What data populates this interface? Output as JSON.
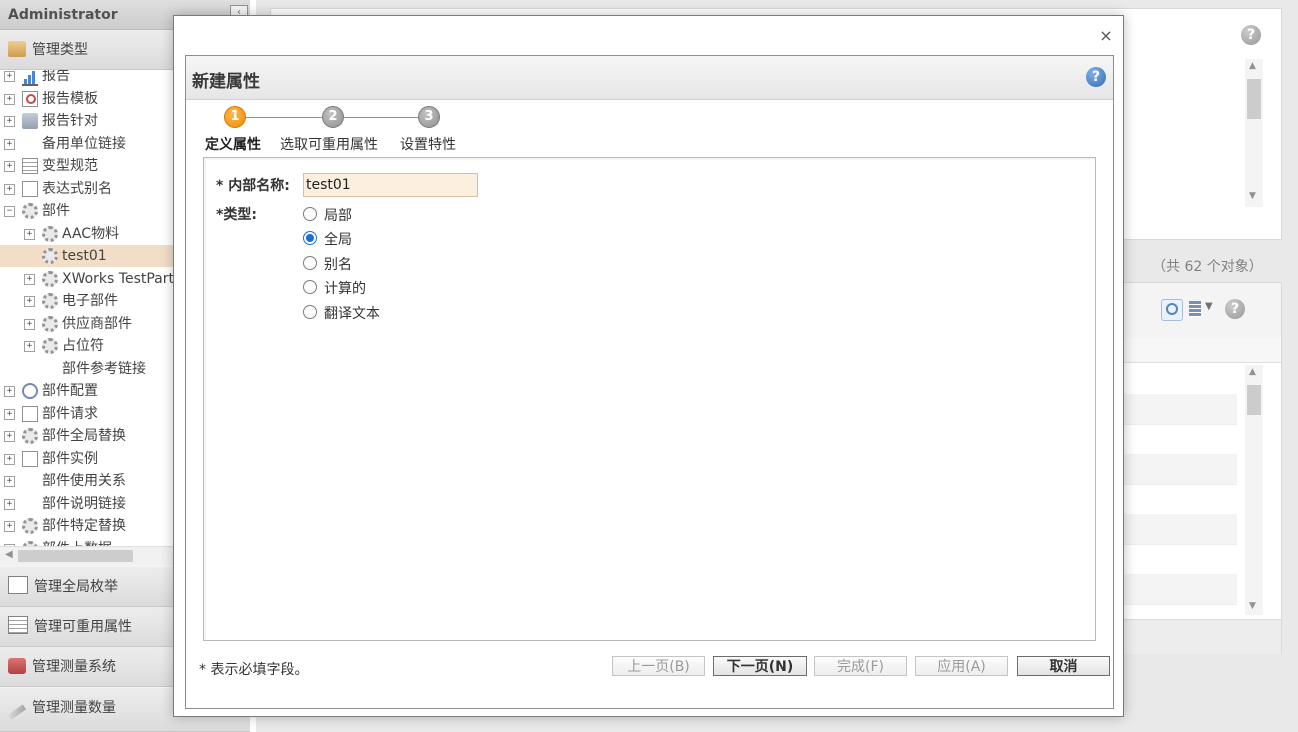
{
  "app": {
    "user": "Administrator",
    "sections": {
      "manage_types": "管理类型",
      "manage_enums": "管理全局枚举",
      "manage_reusable": "管理可重用属性",
      "manage_measure_systems": "管理测量系统",
      "manage_measure_quantities": "管理测量数量"
    },
    "tree": [
      {
        "label": "报告",
        "icon": "chart-icon",
        "expander": "+"
      },
      {
        "label": "报告模板",
        "icon": "report-template-icon",
        "expander": "+"
      },
      {
        "label": "报告针对",
        "icon": "report-target-icon",
        "expander": "+"
      },
      {
        "label": "备用单位链接",
        "icon": "",
        "expander": "+"
      },
      {
        "label": "变型规范",
        "icon": "grid-icon",
        "expander": "+"
      },
      {
        "label": "表达式别名",
        "icon": "expression-icon",
        "expander": "+"
      },
      {
        "label": "部件",
        "icon": "gear-icon",
        "expander": "−"
      },
      {
        "label": "AAC物料",
        "icon": "gear-icon",
        "expander": "+"
      },
      {
        "label": "test01",
        "icon": "gear-icon",
        "expander": ""
      },
      {
        "label": "XWorks TestPart",
        "icon": "gear-icon",
        "expander": "+"
      },
      {
        "label": "电子部件",
        "icon": "gear-icon",
        "expander": "+"
      },
      {
        "label": "供应商部件",
        "icon": "gear-icon",
        "expander": "+"
      },
      {
        "label": "占位符",
        "icon": "gear-icon",
        "expander": "+"
      },
      {
        "label": "部件参考链接",
        "icon": "",
        "expander": ""
      },
      {
        "label": "部件配置",
        "icon": "part-config-icon",
        "expander": "+"
      },
      {
        "label": "部件请求",
        "icon": "part-request-icon",
        "expander": "+"
      },
      {
        "label": "部件全局替换",
        "icon": "gear-icon",
        "expander": "+"
      },
      {
        "label": "部件实例",
        "icon": "part-instance-icon",
        "expander": "+"
      },
      {
        "label": "部件使用关系",
        "icon": "",
        "expander": "+"
      },
      {
        "label": "部件说明链接",
        "icon": "",
        "expander": "+"
      },
      {
        "label": "部件特定替换",
        "icon": "gear-icon",
        "expander": "+"
      },
      {
        "label": "部件上数据",
        "icon": "gear-icon",
        "expander": "+"
      }
    ],
    "object_count": "（共 62 个对象）"
  },
  "dialog": {
    "close": "×",
    "title": "新建属性",
    "help": "?",
    "steps": [
      {
        "number": "1",
        "label": "定义属性"
      },
      {
        "number": "2",
        "label": "选取可重用属性"
      },
      {
        "number": "3",
        "label": "设置特性"
      }
    ],
    "form": {
      "name_label": "* 内部名称:",
      "name_value": "test01",
      "type_label": "*类型:",
      "type_options": [
        "局部",
        "全局",
        "别名",
        "计算的",
        "翻译文本"
      ],
      "selected_type": "全局"
    },
    "required_note": "* 表示必填字段。",
    "buttons": {
      "prev": "上一页(B)",
      "next": "下一页(N)",
      "finish": "完成(F)",
      "apply": "应用(A)",
      "cancel": "取消"
    }
  }
}
